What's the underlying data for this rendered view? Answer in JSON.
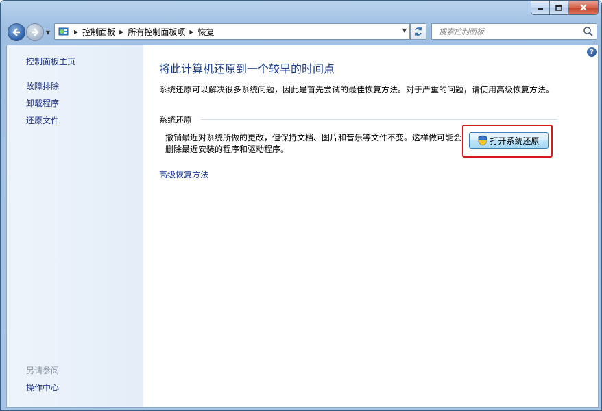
{
  "window": {
    "minimize_icon": "minimize-icon",
    "maximize_icon": "maximize-icon",
    "close_icon": "close-icon"
  },
  "address": {
    "crumbs": [
      "控制面板",
      "所有控制面板项",
      "恢复"
    ]
  },
  "search": {
    "placeholder": "搜索控制面板"
  },
  "sidebar": {
    "home": "控制面板主页",
    "items": [
      "故障排除",
      "卸载程序",
      "还原文件"
    ],
    "see_also_label": "另请参阅",
    "see_also_items": [
      "操作中心"
    ]
  },
  "main": {
    "title": "将此计算机还原到一个较早的时间点",
    "description": "系统还原可以解决很多系统问题，因此是首先尝试的最佳恢复方法。对于严重的问题，请使用高级恢复方法。",
    "group_title": "系统还原",
    "group_text": "撤销最近对系统所做的更改，但保持文档、图片和音乐等文件不变。这样做可能会删除最近安装的程序和驱动程序。",
    "button_label": "打开系统还原",
    "advanced_link": "高级恢复方法",
    "help_label": "?"
  },
  "colors": {
    "link": "#1e3287",
    "title": "#1e3f8a",
    "highlight_border": "#d7191f"
  }
}
